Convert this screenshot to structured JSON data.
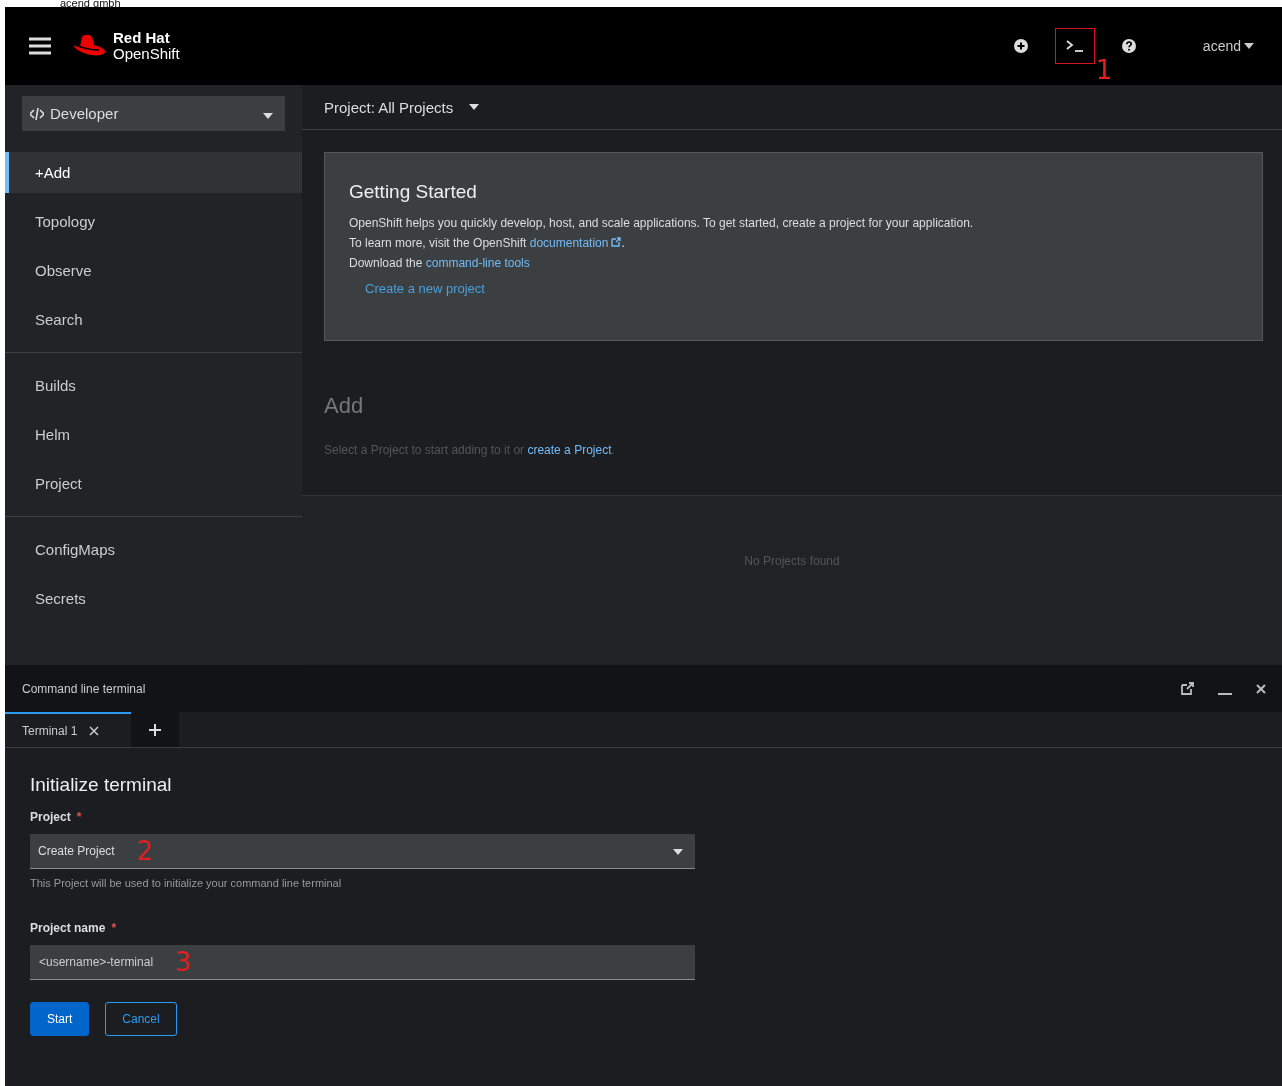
{
  "caption": "acend gmbh",
  "masthead": {
    "brand_top": "Red Hat",
    "brand_bottom": "OpenShift",
    "tools": [
      {
        "kind": "add",
        "highlighted": false
      },
      {
        "kind": "terminal",
        "highlighted": true,
        "annotation": "1"
      },
      {
        "kind": "help",
        "highlighted": false
      }
    ],
    "user": "acend"
  },
  "sidebar": {
    "perspective": "Developer",
    "groups": [
      {
        "items": [
          {
            "label": "+Add",
            "selected": true
          },
          {
            "label": "Topology",
            "selected": false
          },
          {
            "label": "Observe",
            "selected": false
          },
          {
            "label": "Search",
            "selected": false
          }
        ]
      },
      {
        "items": [
          {
            "label": "Builds",
            "selected": false
          },
          {
            "label": "Helm",
            "selected": false
          },
          {
            "label": "Project",
            "selected": false
          }
        ]
      },
      {
        "items": [
          {
            "label": "ConfigMaps",
            "selected": false
          },
          {
            "label": "Secrets",
            "selected": false
          }
        ]
      }
    ]
  },
  "project_bar": {
    "label": "Project: All Projects"
  },
  "getting_started": {
    "title": "Getting Started",
    "lines": [
      {
        "before": "OpenShift helps you quickly develop, host, and scale applications. To get started, create a project for your application."
      },
      {
        "before": "To learn more, visit the OpenShift ",
        "link": "documentation",
        "external": true,
        "after": "."
      },
      {
        "before": "Download the ",
        "link": "command-line tools",
        "external": false
      }
    ],
    "action": "Create a new project"
  },
  "add": {
    "title": "Add",
    "before": "Select a Project to start adding to it or ",
    "link": "create a Project",
    "after": "."
  },
  "empty_state": "No Projects found",
  "terminal": {
    "title": "Command line terminal",
    "tabs": [
      {
        "label": "Terminal 1",
        "selected": true
      }
    ],
    "heading": "Initialize terminal",
    "project": {
      "label": "Project",
      "required_mark": "*",
      "value": "Create Project",
      "annotation": "2",
      "helper": "This Project will be used to initialize your command line terminal"
    },
    "project_name": {
      "label": "Project name",
      "required_mark": "*",
      "value": "<username>-terminal",
      "annotation": "3"
    },
    "buttons": [
      {
        "label": "Start",
        "kind": "primary"
      },
      {
        "label": "Cancel",
        "kind": "secondary"
      }
    ]
  }
}
